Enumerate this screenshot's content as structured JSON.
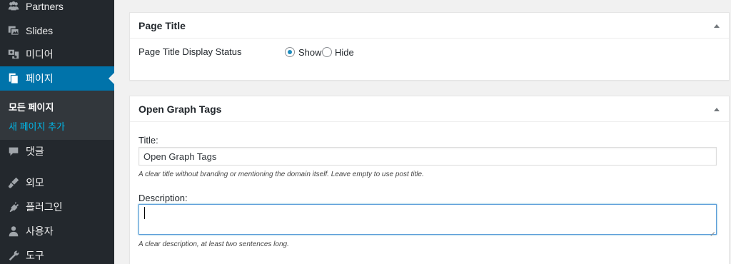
{
  "sidebar": {
    "items": [
      {
        "label": "Partners",
        "icon": "partners-icon"
      },
      {
        "label": "Slides",
        "icon": "slides-icon"
      },
      {
        "label": "미디어",
        "icon": "media-icon"
      },
      {
        "label": "페이지",
        "icon": "pages-icon",
        "current": true
      },
      {
        "label": "댓글",
        "icon": "comments-icon"
      },
      {
        "label": "외모",
        "icon": "appearance-icon"
      },
      {
        "label": "플러그인",
        "icon": "plugins-icon"
      },
      {
        "label": "사용자",
        "icon": "users-icon"
      },
      {
        "label": "도구",
        "icon": "tools-icon"
      }
    ],
    "submenu": [
      {
        "label": "모든 페이지",
        "active": true
      },
      {
        "label": "새 페이지 추가",
        "active": false
      }
    ]
  },
  "page_title_box": {
    "title": "Page Title",
    "display_status_label": "Page Title Display Status",
    "options": [
      {
        "label": "Show",
        "checked": true
      },
      {
        "label": "Hide",
        "checked": false
      }
    ]
  },
  "og_box": {
    "title": "Open Graph Tags",
    "title_field_label": "Title:",
    "title_field_value": "Open Graph Tags",
    "title_help": "A clear title without branding or mentioning the domain itself. Leave empty to use post title.",
    "description_label": "Description:",
    "description_value": "",
    "description_help": "A clear description, at least two sentences long."
  },
  "colors": {
    "sidebar_bg": "#23282d",
    "submenu_bg": "#32373c",
    "current_bg": "#0073aa",
    "link": "#00b9eb"
  }
}
